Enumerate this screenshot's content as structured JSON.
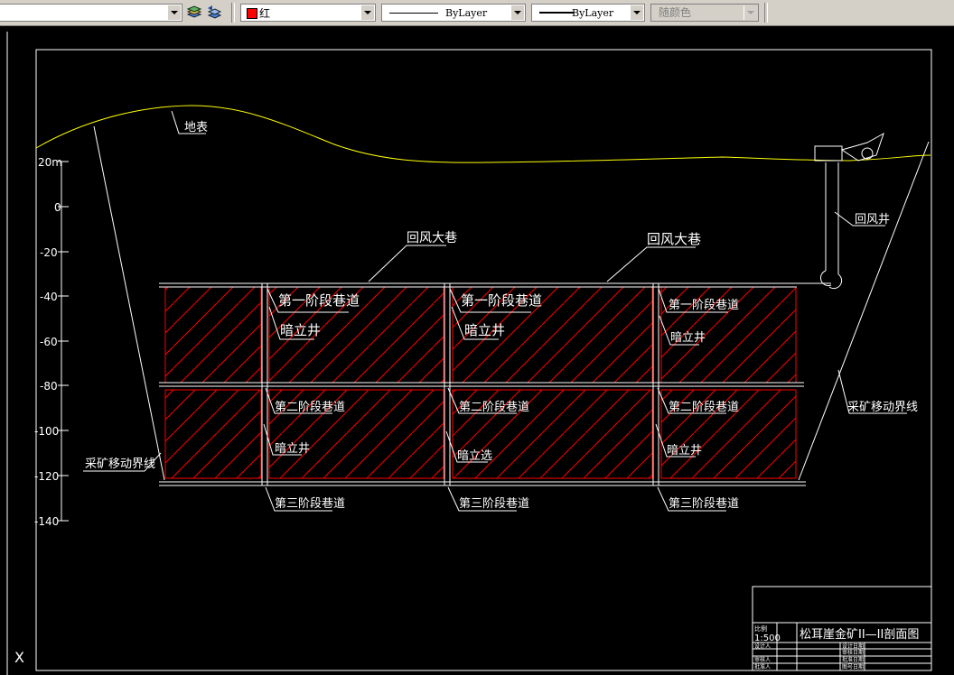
{
  "toolbar": {
    "color_value": "红",
    "linetype_value": "ByLayer",
    "lineweight_value": "ByLayer",
    "plotstyle_value": "随颜色",
    "colors": {
      "red": "#ff0000",
      "toolbar_bg": "#d4d0c8"
    },
    "icons": [
      "layer-states-icon",
      "layer-previous-icon"
    ]
  },
  "drawing": {
    "axis_labels": [
      "20m",
      "0",
      "-20",
      "-40",
      "-60",
      "-80",
      "-100",
      "-120",
      "-140"
    ],
    "surface_label": "地表",
    "return_shaft_label": "回风井",
    "return_drift_labels": [
      "回风大巷",
      "回风大巷"
    ],
    "level1_labels": [
      "第一阶段巷道",
      "第一阶段巷道",
      "第一阶段巷道"
    ],
    "raise_upper_labels": [
      "暗立井",
      "暗立井",
      "暗立井"
    ],
    "level2_labels": [
      "第二阶段巷道",
      "第二阶段巷道",
      "第二阶段巷道"
    ],
    "raise_lower_labels": [
      "暗立井",
      "暗立选",
      "暗立井"
    ],
    "level3_labels": [
      "第三阶段巷道",
      "第三阶段巷道",
      "第三阶段巷道"
    ],
    "boundary_left_label": "采矿移动界线",
    "boundary_right_label": "采矿移动界线",
    "crosshair_label": "X",
    "colors": {
      "ore_body": "#ff0000",
      "surface": "#ffff00",
      "lines": "#ffffff",
      "background": "#000000"
    }
  },
  "title_block": {
    "scale_header": "比例",
    "scale_value": "1:500",
    "title": "松耳崖金矿II—II剖面图",
    "row_labels": [
      "设计人",
      "审核人",
      "批准人"
    ],
    "cell_values": [
      "设计日期",
      "审核日期",
      "批准日期",
      "图号日期"
    ]
  }
}
